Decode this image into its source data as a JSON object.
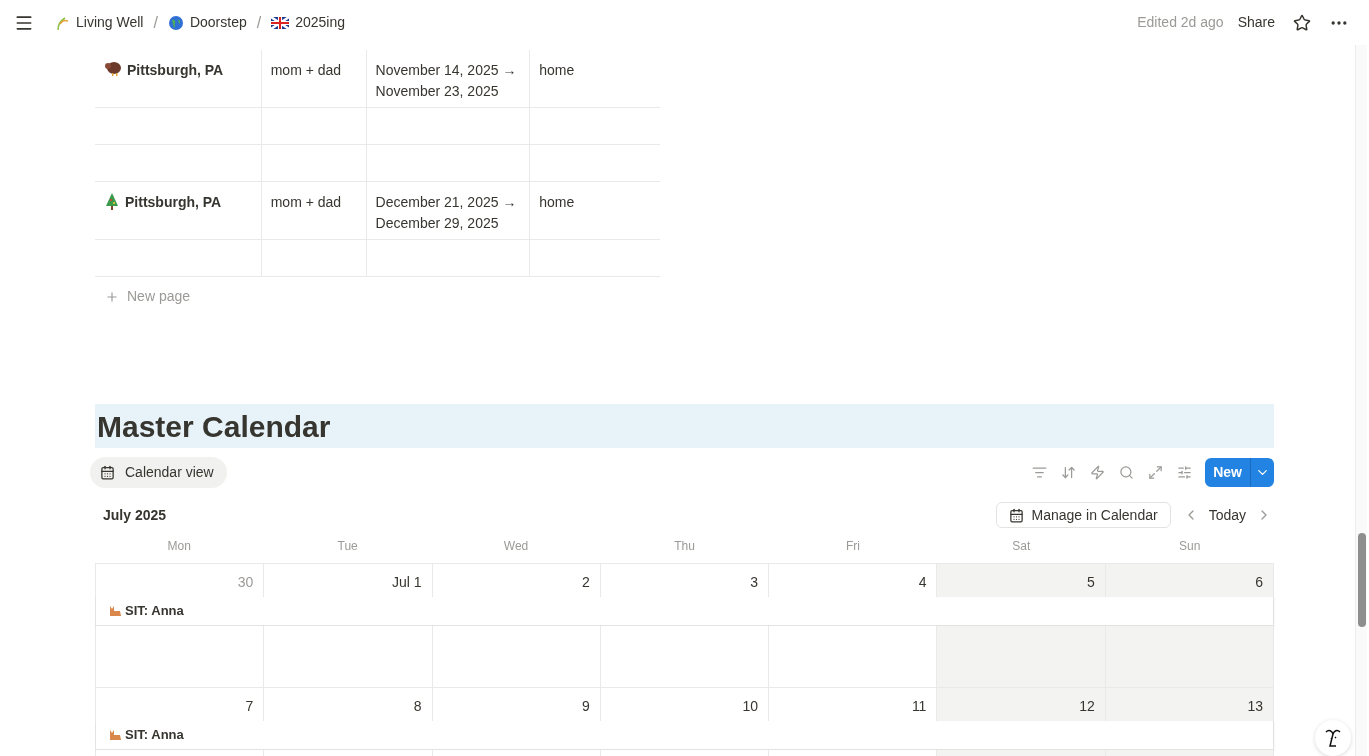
{
  "breadcrumbs": [
    {
      "label": "Living Well"
    },
    {
      "separator": "/",
      "label": "Doorstep"
    },
    {
      "separator": "/",
      "label": "2025ing"
    }
  ],
  "topbar": {
    "edited": "Edited 2d ago",
    "share": "Share"
  },
  "table": {
    "rows": [
      {
        "cells": [
          "Pittsburgh, PA",
          "mom + dad",
          "November 14, 2025 → November 23, 2025",
          "home"
        ]
      },
      {
        "cells": []
      },
      {
        "cells": []
      },
      {
        "cells": [
          "Pittsburgh, PA",
          "mom + dad",
          "December 21, 2025 → December 29, 2025",
          "home"
        ]
      },
      {
        "cells": []
      }
    ],
    "new_page": "New page"
  },
  "calendar": {
    "heading": "Master Calendar",
    "view_tab": "Calendar view",
    "new_button": "New",
    "month": "July 2025",
    "manage": "Manage in Calendar",
    "today": "Today",
    "weekdays": [
      "Mon",
      "Tue",
      "Wed",
      "Thu",
      "Fri",
      "Sat",
      "Sun"
    ],
    "weeks": [
      {
        "days": [
          {
            "label": "30",
            "outside_month": true,
            "weekend": false
          },
          {
            "label": "Jul 1",
            "outside_month": false,
            "weekend": false
          },
          {
            "label": "2",
            "outside_month": false,
            "weekend": false
          },
          {
            "label": "3",
            "outside_month": false,
            "weekend": false
          },
          {
            "label": "4",
            "outside_month": false,
            "weekend": false
          },
          {
            "label": "5",
            "outside_month": false,
            "weekend": true
          },
          {
            "label": "6",
            "outside_month": false,
            "weekend": true
          }
        ],
        "event": "SIT: Anna"
      },
      {
        "days": [
          {
            "label": "7",
            "outside_month": false,
            "weekend": false
          },
          {
            "label": "8",
            "outside_month": false,
            "weekend": false
          },
          {
            "label": "9",
            "outside_month": false,
            "weekend": false
          },
          {
            "label": "10",
            "outside_month": false,
            "weekend": false
          },
          {
            "label": "11",
            "outside_month": false,
            "weekend": false
          },
          {
            "label": "12",
            "outside_month": false,
            "weekend": true
          },
          {
            "label": "13",
            "outside_month": false,
            "weekend": true
          }
        ],
        "event": "SIT: Anna"
      }
    ]
  }
}
